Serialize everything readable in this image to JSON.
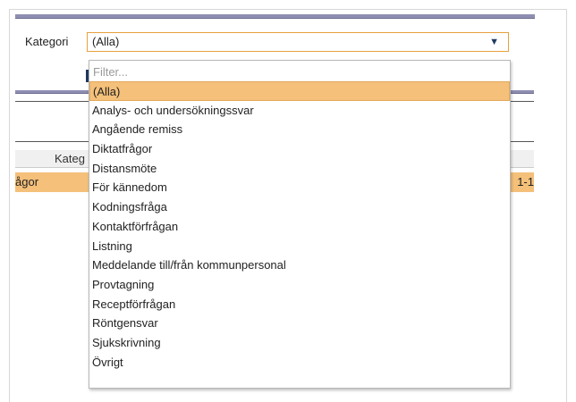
{
  "form": {
    "kategori_label": "Kategori",
    "selected_value": "(Alla)",
    "filter_placeholder": "Filter..."
  },
  "options": [
    "(Alla)",
    "Analys- och undersökningssvar",
    "Angående remiss",
    "Diktatfrågor",
    "Distansmöte",
    "För kännedom",
    "Kodningsfråga",
    "Kontaktförfrågan",
    "Listning",
    "Meddelande till/från kommunpersonal",
    "Provtagning",
    "Receptförfrågan",
    "Röntgensvar",
    "Sjukskrivning",
    "Övrigt"
  ],
  "background": {
    "header_fragment": "Kateg",
    "row_left": "ågor",
    "row_right": "1-1"
  },
  "colors": {
    "accent_bar": "#8f8fb3",
    "selected_bg": "#f4c07a",
    "select_border": "#e8a040"
  },
  "icons": {
    "dropdown_arrow": "triangle-down"
  }
}
